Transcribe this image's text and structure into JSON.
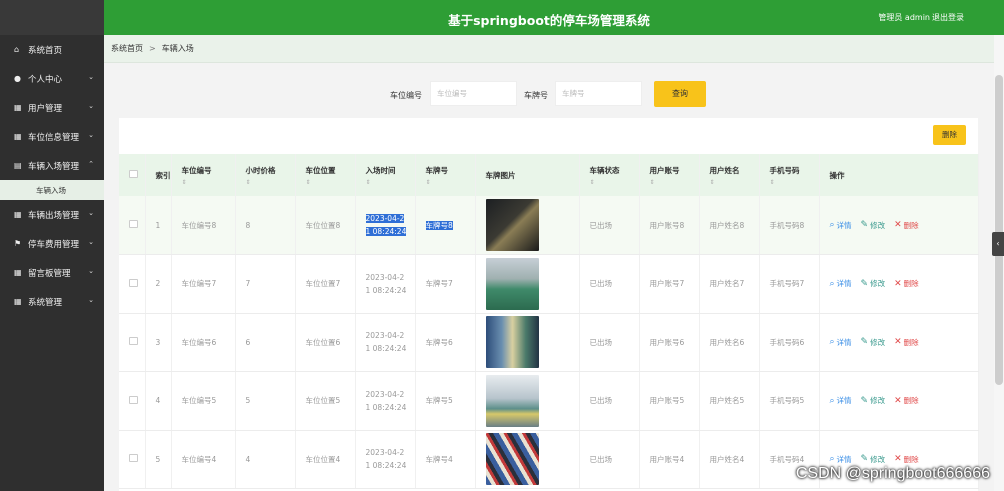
{
  "header": {
    "title": "基于springboot的停车场管理系统",
    "user": "管理员 admin",
    "logout": "退出登录"
  },
  "sidebar": {
    "items": [
      {
        "label": "系统首页",
        "icon": "home-icon",
        "expandable": false
      },
      {
        "label": "个人中心",
        "icon": "user-icon",
        "expandable": true
      },
      {
        "label": "用户管理",
        "icon": "grid-icon",
        "expandable": true
      },
      {
        "label": "车位信息管理",
        "icon": "grid-icon",
        "expandable": true
      },
      {
        "label": "车辆入场管理",
        "icon": "clipboard-icon",
        "expandable": true,
        "expanded": true
      },
      {
        "label": "车辆出场管理",
        "icon": "grid-icon",
        "expandable": true
      },
      {
        "label": "停车费用管理",
        "icon": "flag-icon",
        "expandable": true
      },
      {
        "label": "留言板管理",
        "icon": "grid-icon",
        "expandable": true
      },
      {
        "label": "系统管理",
        "icon": "grid-icon",
        "expandable": true
      }
    ],
    "active_sub": "车辆入场"
  },
  "breadcrumb": {
    "home": "系统首页",
    "sep": ">",
    "current": "车辆入场"
  },
  "search": {
    "space_label": "车位编号",
    "space_placeholder": "车位编号",
    "plate_label": "车牌号",
    "plate_placeholder": "车牌号",
    "query": "查询"
  },
  "toolbar": {
    "delete": "删除"
  },
  "table": {
    "headers": [
      "",
      "索引",
      "车位编号",
      "小时价格",
      "车位位置",
      "入场时间",
      "车牌号",
      "车牌图片",
      "车辆状态",
      "用户账号",
      "用户姓名",
      "手机号码",
      "操作"
    ],
    "sort_glyph": "⇕",
    "actions": {
      "view": "详情",
      "edit": "修改",
      "remove": "删除"
    },
    "rows": [
      {
        "index": "1",
        "space": "车位编号8",
        "price": "8",
        "location": "车位位置8",
        "time_a": "2023-04-2",
        "time_b": "1 08:24:24",
        "plate": "车牌号8",
        "status": "已出场",
        "account": "用户账号8",
        "name": "用户姓名8",
        "phone": "手机号码8",
        "img": "dark-garage",
        "highlight": true
      },
      {
        "index": "2",
        "space": "车位编号7",
        "price": "7",
        "location": "车位位置7",
        "time_a": "2023-04-2",
        "time_b": "1 08:24:24",
        "plate": "车牌号7",
        "status": "已出场",
        "account": "用户账号7",
        "name": "用户姓名7",
        "phone": "手机号码7",
        "img": "green-floor",
        "highlight": false
      },
      {
        "index": "3",
        "space": "车位编号6",
        "price": "6",
        "location": "车位位置6",
        "time_a": "2023-04-2",
        "time_b": "1 08:24:24",
        "plate": "车牌号6",
        "status": "已出场",
        "account": "用户账号6",
        "name": "用户姓名6",
        "phone": "手机号码6",
        "img": "pillar-garage",
        "highlight": false
      },
      {
        "index": "4",
        "space": "车位编号5",
        "price": "5",
        "location": "车位位置5",
        "time_a": "2023-04-2",
        "time_b": "1 08:24:24",
        "plate": "车牌号5",
        "status": "已出场",
        "account": "用户账号5",
        "name": "用户姓名5",
        "phone": "手机号码5",
        "img": "bright-garage",
        "highlight": false
      },
      {
        "index": "5",
        "space": "车位编号4",
        "price": "4",
        "location": "车位位置4",
        "time_a": "2023-04-2",
        "time_b": "1 08:24:24",
        "plate": "车牌号4",
        "status": "已出场",
        "account": "用户账号4",
        "name": "用户姓名4",
        "phone": "手机号码4",
        "img": "striped-lot",
        "highlight": false
      }
    ]
  },
  "watermark": "CSDN @springboot666666"
}
